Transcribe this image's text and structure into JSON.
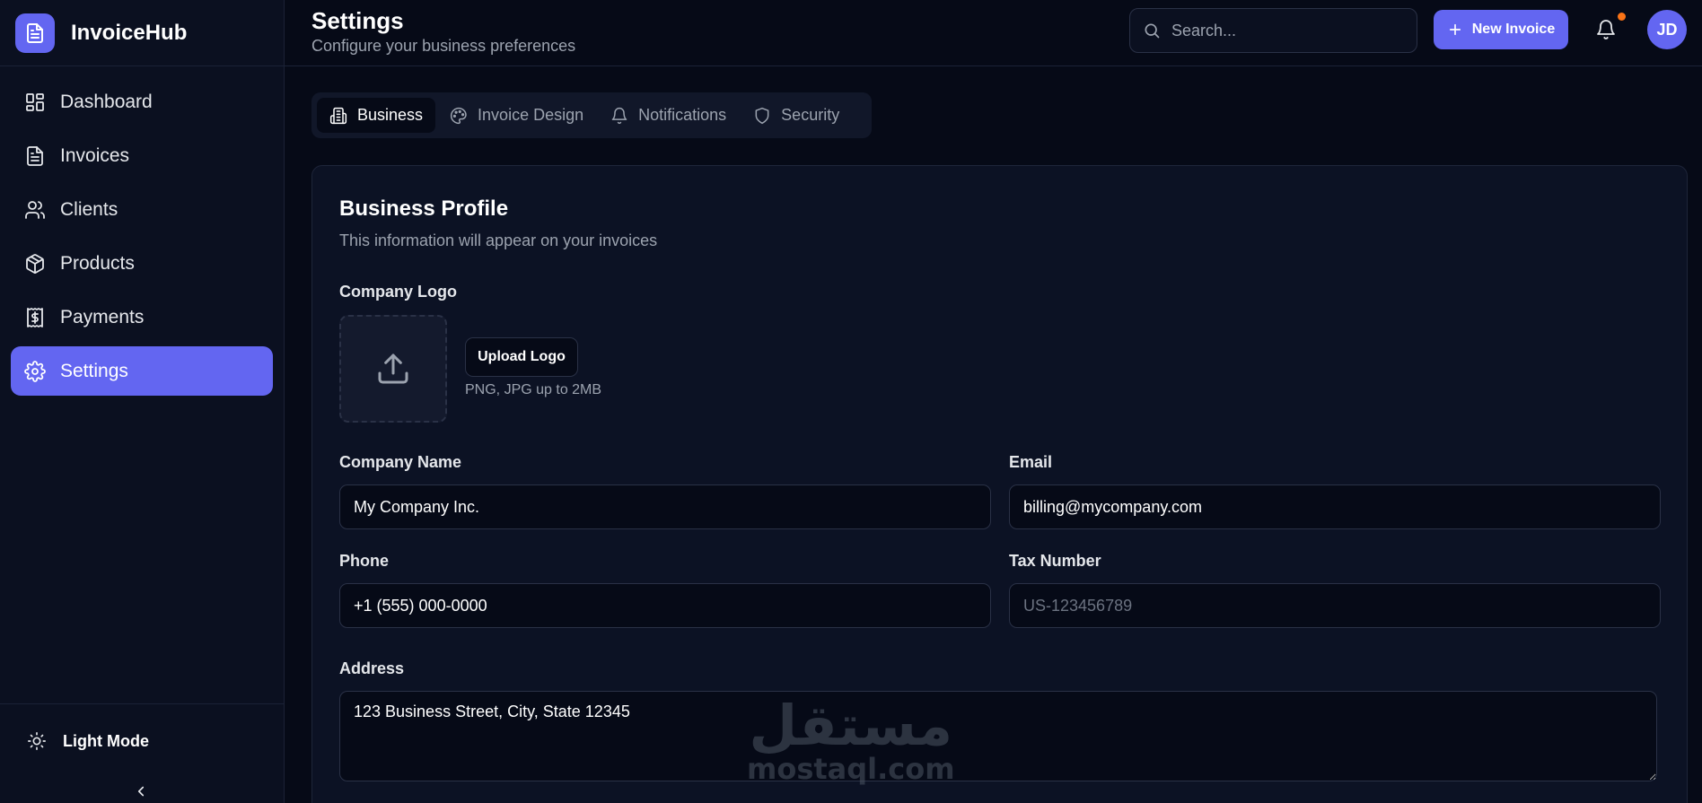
{
  "app": {
    "name": "InvoiceHub"
  },
  "sidebar": {
    "items": [
      {
        "label": "Dashboard",
        "icon": "dashboard-icon"
      },
      {
        "label": "Invoices",
        "icon": "invoice-file-icon"
      },
      {
        "label": "Clients",
        "icon": "users-icon"
      },
      {
        "label": "Products",
        "icon": "package-icon"
      },
      {
        "label": "Payments",
        "icon": "receipt-dollar-icon"
      },
      {
        "label": "Settings",
        "icon": "gear-icon",
        "active": true
      }
    ],
    "theme_toggle": "Light Mode"
  },
  "header": {
    "title": "Settings",
    "subtitle": "Configure your business preferences",
    "search_placeholder": "Search...",
    "new_invoice_label": "New Invoice",
    "avatar_initials": "JD"
  },
  "tabs": [
    {
      "label": "Business",
      "icon": "building-icon",
      "active": true
    },
    {
      "label": "Invoice Design",
      "icon": "palette-icon"
    },
    {
      "label": "Notifications",
      "icon": "bell-icon"
    },
    {
      "label": "Security",
      "icon": "shield-icon"
    }
  ],
  "profile": {
    "title": "Business Profile",
    "subtitle": "This information will appear on your invoices",
    "logo_label": "Company Logo",
    "upload_label": "Upload Logo",
    "upload_hint": "PNG, JPG up to 2MB",
    "company_name_label": "Company Name",
    "company_name_value": "My Company Inc.",
    "email_label": "Email",
    "email_value": "billing@mycompany.com",
    "phone_label": "Phone",
    "phone_value": "+1 (555) 000-0000",
    "tax_label": "Tax Number",
    "tax_placeholder": "US-123456789",
    "address_label": "Address",
    "address_value": "123 Business Street, City, State 12345"
  },
  "watermark": {
    "arabic": "مستقل",
    "latin": "mostaql.com"
  },
  "colors": {
    "accent": "#6366f1",
    "background": "#060a17",
    "sidebar": "#0b1020",
    "notification_dot": "#f97316"
  }
}
